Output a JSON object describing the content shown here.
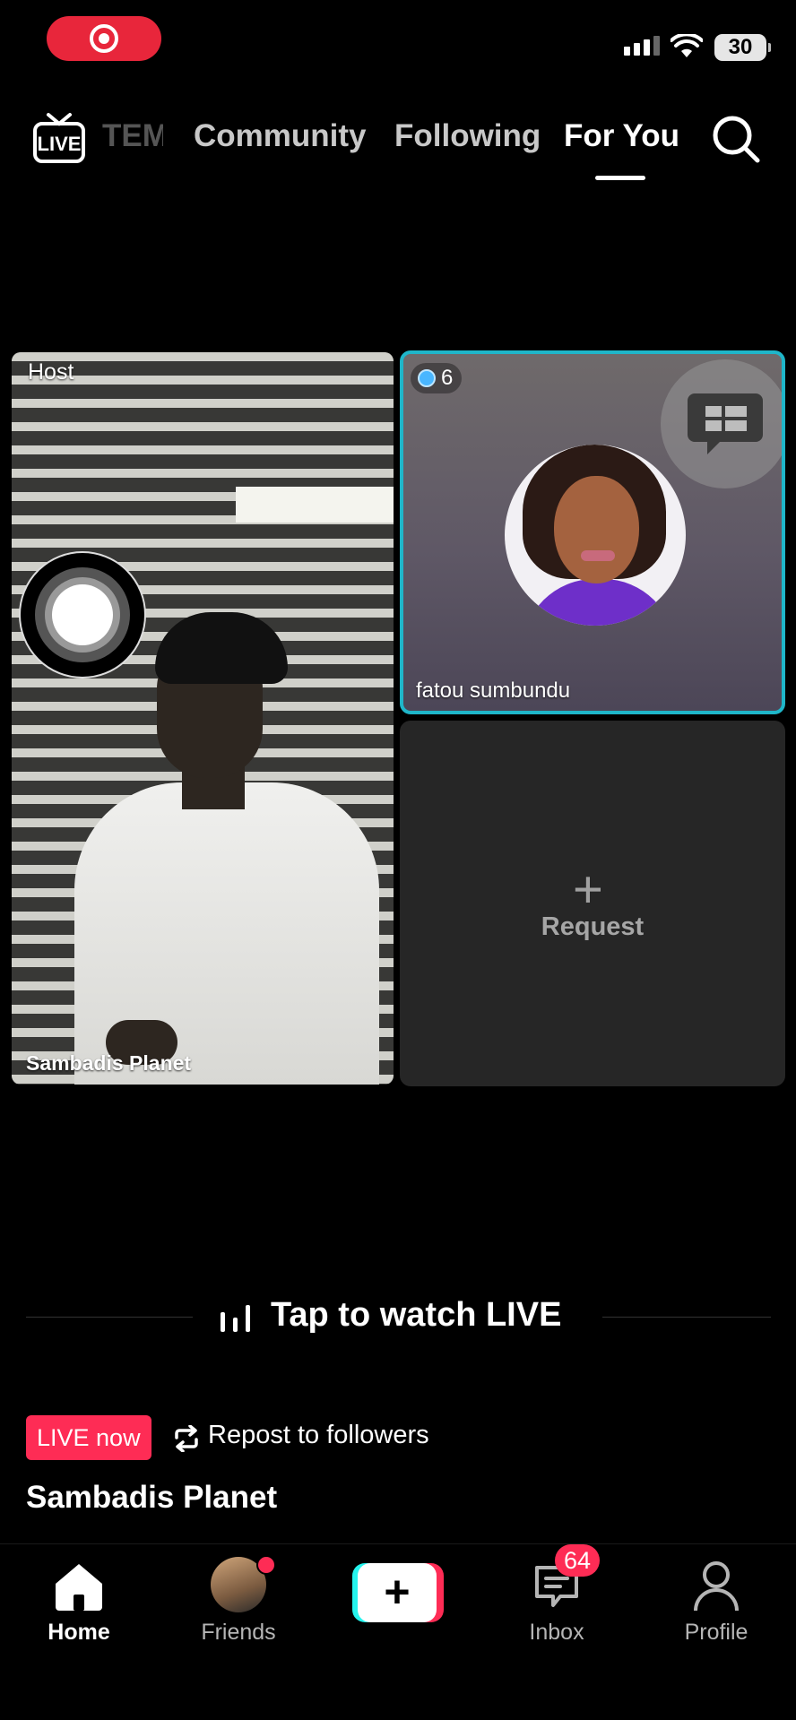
{
  "status_bar": {
    "battery": "30",
    "recording_icon": "record-icon"
  },
  "nav": {
    "live_icon": "live-tv-icon",
    "tabs": [
      {
        "label": "TEM",
        "partial": true
      },
      {
        "label": "Community"
      },
      {
        "label": "Following"
      },
      {
        "label": "For You",
        "active": true
      }
    ],
    "search_icon": "search-icon"
  },
  "live_grid": {
    "host": {
      "badge": "Host",
      "name": "Sambadis Planet"
    },
    "guest": {
      "gift_count": "6",
      "name": "fatou sumbundu",
      "border_color": "#1fb6c9"
    },
    "request": {
      "label": "Request",
      "plus": "+"
    }
  },
  "tap_to_watch": "Tap to watch LIVE",
  "live_info": {
    "badge": "LIVE now",
    "repost": "Repost to followers",
    "streamer": "Sambadis Planet"
  },
  "bottom_nav": {
    "home": "Home",
    "friends": "Friends",
    "create": "+",
    "inbox": "Inbox",
    "inbox_badge": "64",
    "profile": "Profile"
  },
  "colors": {
    "accent": "#fe2c55",
    "cyan": "#25f4ee",
    "guest_border": "#1fb6c9"
  }
}
